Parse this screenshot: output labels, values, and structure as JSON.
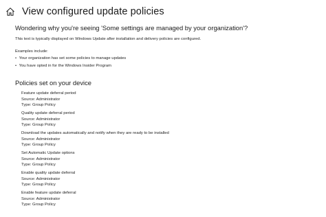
{
  "header": {
    "title": "View configured update policies",
    "home_icon": "home-icon"
  },
  "intro": {
    "question": "Wondering why you're seeing 'Some settings are managed by your organization'?",
    "description": "This text is typically displayed on Windows Update after installation and delivery policies are configured.",
    "examples_label": "Examples include:",
    "examples": [
      "Your organization has set some policies to manage updates",
      "You have opted in for the Windows Insider Program"
    ]
  },
  "policies_section": {
    "title": "Policies set on your device",
    "policies": [
      {
        "name": "Feature update deferral period",
        "source": "Source: Administrator",
        "type": "Type: Group Policy"
      },
      {
        "name": "Quality update deferral period",
        "source": "Source: Administrator",
        "type": "Type: Group Policy"
      },
      {
        "name": "Download the updates automatically and notify when they are ready to be installed",
        "source": "Source: Administrator",
        "type": "Type: Group Policy"
      },
      {
        "name": "Set Automatic Update options",
        "source": "Source: Administrator",
        "type": "Type: Group Policy"
      },
      {
        "name": "Enable quality update deferral",
        "source": "Source: Administrator",
        "type": "Type: Group Policy"
      },
      {
        "name": "Enable feature update deferral",
        "source": "Source: Administrator",
        "type": "Type: Group Policy"
      }
    ]
  }
}
